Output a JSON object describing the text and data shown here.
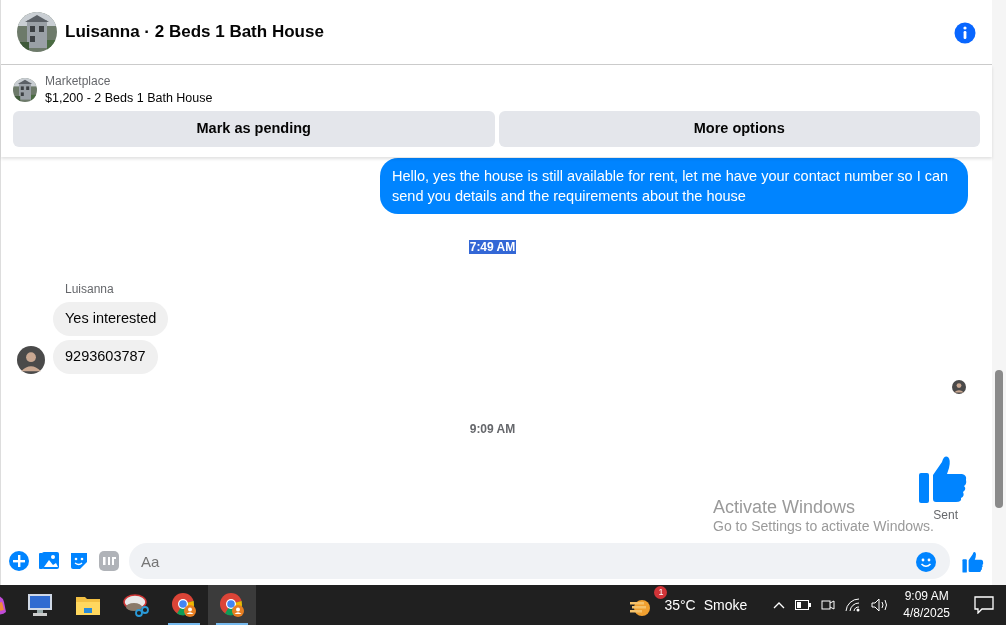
{
  "header": {
    "title": "Luisanna · 2 Beds 1 Bath House"
  },
  "listing": {
    "source": "Marketplace",
    "title": "$1,200 - 2 Beds 1 Bath House"
  },
  "actions": [
    "Mark as pending",
    "More options"
  ],
  "messages": [
    {
      "kind": "outgoing",
      "text": "Hello, yes the house is still available for rent, let me have your contact number so I can send you details and the requirements about the house"
    },
    {
      "kind": "timestamp",
      "text": "7:49 AM",
      "selected": true
    },
    {
      "kind": "incoming",
      "sender": "Luisanna",
      "bubbles": [
        "Yes interested",
        "9293603787"
      ]
    },
    {
      "kind": "seen"
    },
    {
      "kind": "timestamp",
      "text": "9:09 AM",
      "selected": false
    },
    {
      "kind": "like",
      "status": "Sent"
    }
  ],
  "composer": {
    "placeholder": "Aa"
  },
  "overlay": {
    "title": "Activate Windows",
    "text": "Go to Settings to activate Windows."
  },
  "taskbar": {
    "apps": [
      {
        "kind": "copilot",
        "running": false,
        "active": false
      },
      {
        "kind": "remote",
        "running": false,
        "active": false
      },
      {
        "kind": "folder",
        "running": false,
        "active": false
      },
      {
        "kind": "snip",
        "running": false,
        "active": false
      },
      {
        "kind": "chrome",
        "running": true,
        "active": false
      },
      {
        "kind": "chrome",
        "running": true,
        "active": true
      }
    ],
    "weather": {
      "badge": "1",
      "temperature": "35°C",
      "condition": "Smoke"
    },
    "time": "9:09 AM",
    "date": "4/8/2025"
  }
}
